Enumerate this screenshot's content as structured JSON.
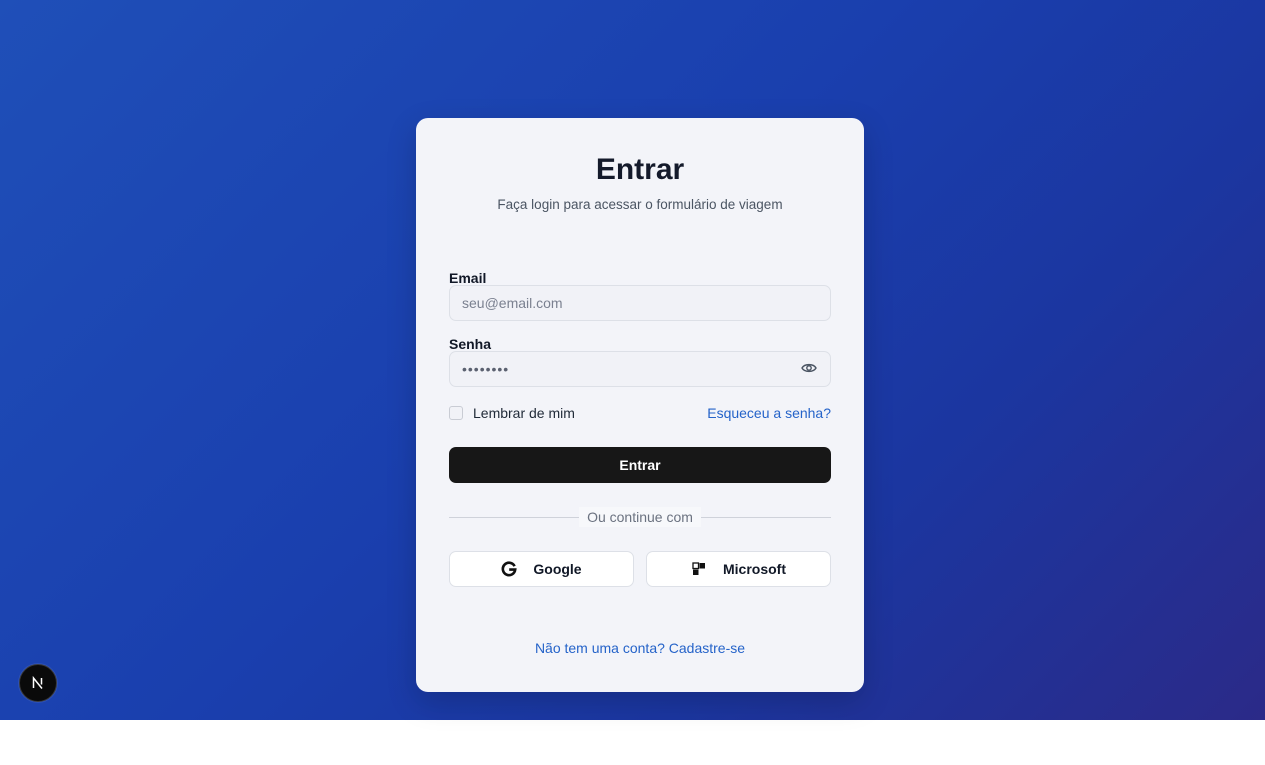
{
  "login": {
    "title": "Entrar",
    "subtitle": "Faça login para acessar o formulário de viagem",
    "email": {
      "label": "Email",
      "placeholder": "seu@email.com",
      "value": ""
    },
    "password": {
      "label": "Senha",
      "placeholder": "••••••••",
      "value": "",
      "toggle_icon": "eye-icon"
    },
    "remember_label": "Lembrar de mim",
    "remember_checked": false,
    "forgot_link": "Esqueceu a senha?",
    "submit_label": "Entrar",
    "divider_text": "Ou continue com",
    "social": [
      {
        "label": "Google",
        "icon": "google-icon"
      },
      {
        "label": "Microsoft",
        "icon": "microsoft-icon"
      }
    ],
    "signup_link": "Não tem uma conta? Cadastre-se"
  },
  "badge": {
    "letter": "N",
    "icon": "nextjs-icon"
  },
  "colors": {
    "background_start": "#1f4fb8",
    "background_end": "#2b2a88",
    "card": "#f3f4f9",
    "primary_button": "#171717",
    "link": "#2563c9"
  }
}
